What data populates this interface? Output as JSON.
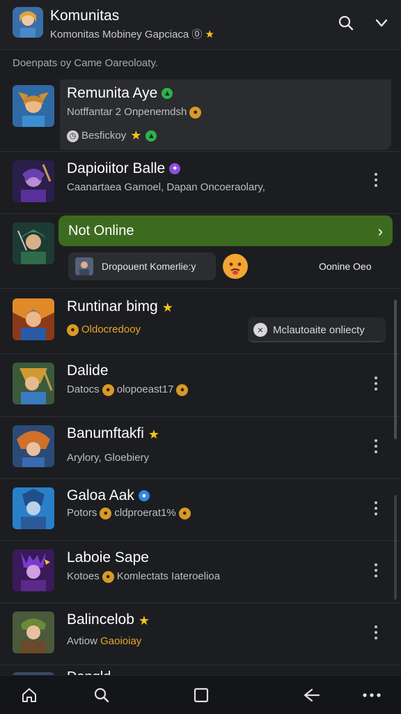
{
  "header": {
    "title": "Komunitas",
    "subtitle": "Komonitas Mobiney Gapciaca ⓪",
    "icons": [
      "search-icon",
      "chevron-down-icon"
    ]
  },
  "section_label": "Doenpats oy Came Oareoloaty.",
  "items": [
    {
      "name": "Remunita Aye",
      "sub": "Notffantar 2 Onpenemdsh",
      "sub2": "Besfickoy"
    },
    {
      "name": "Dapioiitor Balle",
      "sub": "Caanartaea Gamoel, Dapan Oncoeraolary,"
    },
    {
      "name": "Runtinar bimg",
      "sub": "Oldocredooy"
    },
    {
      "name": "Dalide",
      "sub": "Datocs",
      "sub_tail": "olopoeast17"
    },
    {
      "name": "Banumftakfi",
      "sub": "Arylory, Gloebiery"
    },
    {
      "name": "Galoa Aak",
      "sub": "Potors",
      "sub_tail": "cldproerat1%"
    },
    {
      "name": "Laboie Sape",
      "sub": "Kotoes",
      "sub_tail": "Komlectats Iateroelioa"
    },
    {
      "name": "Balincelob",
      "sub_prefix": "Avtiow",
      "sub": "Gaoioiay"
    },
    {
      "name": "Dangld"
    }
  ],
  "online_bar": {
    "label": "Not Online",
    "chip_label": "Dropouent Komerlie:y",
    "status": "Oonine Oeo"
  },
  "mod_pill": {
    "label": "Mclautoaite onliecty"
  },
  "colors": {
    "accent_green": "#3c6b20",
    "star": "#f5c518",
    "gold_text": "#e9a52b"
  },
  "bottom_nav": [
    "home-icon",
    "search-icon",
    "square-icon",
    "back-icon",
    "more-icon"
  ]
}
